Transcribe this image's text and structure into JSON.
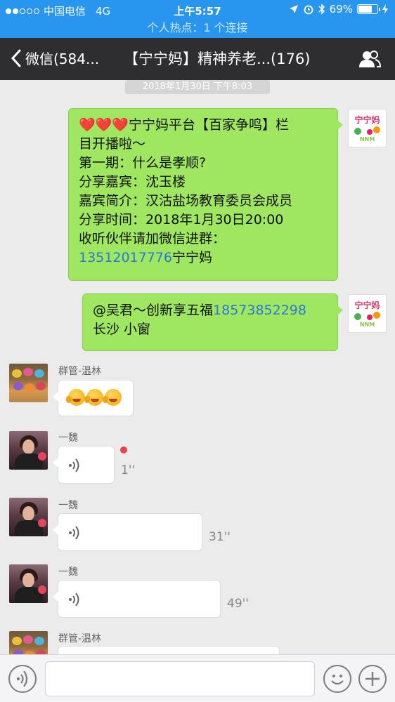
{
  "status_bar": {
    "carrier": "中国电信",
    "network": "4G",
    "time": "上午5:57",
    "battery": "69%",
    "hotspot": "个人热点：1 个连接"
  },
  "nav": {
    "back_label": "微信(584...",
    "title": "【宁宁妈】精神养老...(176)"
  },
  "chat": {
    "timestamp": "2018年1月30日 下午8:03",
    "messages": [
      {
        "lines": [
          "❤️❤️❤️宁宁妈平台【百家争鸣】栏",
          "目开播啦～",
          "第一期：什么是孝顺?",
          "分享嘉宾：沈玉楼",
          "嘉宾简介：汉沽盐场教育委员会成员",
          "分享时间：2018年1月30日20:00",
          "收听伙伴请加微信进群："
        ],
        "phone": "13512017776",
        "phone_suffix": "宁宁妈"
      },
      {
        "prefix": "@吴君～创新享五福",
        "phone": "18573852298",
        "line2": "长沙 小窗"
      }
    ],
    "own_avatar": {
      "text": "宁宁妈",
      "sub": "NNM"
    },
    "voice_messages": [
      {
        "sender": "群管-温林"
      },
      {
        "sender": "一魏",
        "duration": "1''"
      },
      {
        "sender": "一魏",
        "duration": "31''"
      },
      {
        "sender": "一魏",
        "duration": "49''"
      },
      {
        "sender": "群管-温林"
      }
    ]
  },
  "colors": {
    "status_bar": "#2896ef",
    "nav_bar": "#2e2e32",
    "chat_bg": "#ebebeb",
    "own_bubble": "#9fe760",
    "link": "#2a79d6"
  }
}
